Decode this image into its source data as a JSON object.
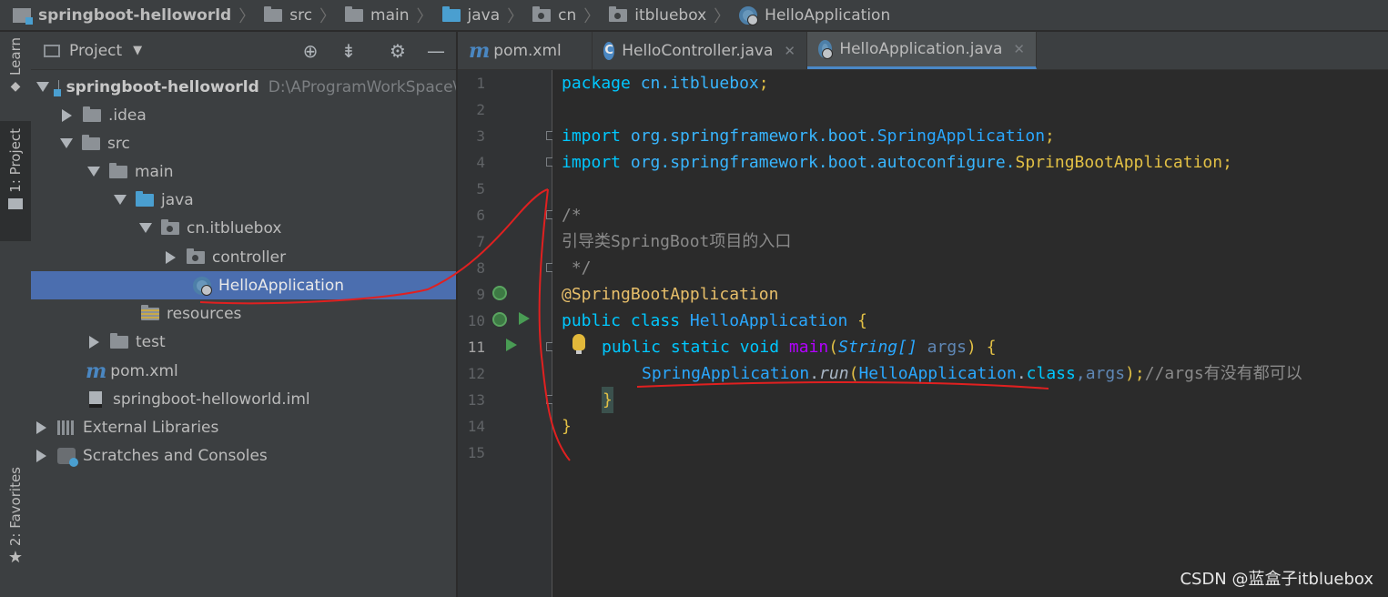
{
  "breadcrumb": {
    "items": [
      "springboot-helloworld",
      "src",
      "main",
      "java",
      "cn",
      "itbluebox",
      "HelloApplication"
    ]
  },
  "tool_strip": {
    "learn": "Learn",
    "project": "1: Project",
    "favorites": "2: Favorites"
  },
  "project_panel": {
    "title": "Project",
    "tree": [
      {
        "label": "springboot-helloworld",
        "hint": "D:\\AProgramWorkSpace\\i"
      },
      {
        "label": ".idea"
      },
      {
        "label": "src"
      },
      {
        "label": "main"
      },
      {
        "label": "java"
      },
      {
        "label": "cn.itbluebox"
      },
      {
        "label": "controller"
      },
      {
        "label": "HelloApplication"
      },
      {
        "label": "resources"
      },
      {
        "label": "test"
      },
      {
        "label": "pom.xml"
      },
      {
        "label": "springboot-helloworld.iml"
      },
      {
        "label": "External Libraries"
      },
      {
        "label": "Scratches and Consoles"
      }
    ]
  },
  "editor_tabs": [
    {
      "label": "pom.xml"
    },
    {
      "label": "HelloController.java"
    },
    {
      "label": "HelloApplication.java"
    }
  ],
  "gutter": {
    "lines": [
      "1",
      "2",
      "3",
      "4",
      "5",
      "6",
      "7",
      "8",
      "9",
      "10",
      "11",
      "12",
      "13",
      "14",
      "15"
    ]
  },
  "code": {
    "l1": {
      "kw": "package",
      "pkg": "cn.itbluebox",
      "semi": ";"
    },
    "l3": {
      "kw": "import",
      "pkg": "org.springframework.boot.",
      "cls": "SpringApplication",
      "semi": ";"
    },
    "l4": {
      "kw": "import",
      "pkg": "org.springframework.boot.autoconfigure.",
      "cls": "SpringBootApplication",
      "semi": ";"
    },
    "l6": "/*",
    "l7": "引导类SpringBoot项目的入口",
    "l8": " */",
    "l9": "@SpringBootApplication",
    "l10": {
      "kw": "public class",
      "cls": "HelloApplication",
      "brace": "{"
    },
    "l11": {
      "kw": "public static void",
      "mn": "main",
      "p1": "(",
      "typ": "String[]",
      "prm": "args",
      "p2": ") {"
    },
    "l12": {
      "cls1": "SpringApplication",
      "dot": ".",
      "mth": "run",
      "p1": "(",
      "cls2": "HelloApplication",
      "dot2": ".",
      "kwc": "class",
      "rest": ",args",
      "p2": ");",
      "cm": "//args有没有都可以"
    },
    "l13": "}",
    "l14": "}"
  },
  "watermark": "CSDN @蓝盒子itbluebox",
  "colors": {
    "annotation_red": "#e02020",
    "selection": "#4b6eaf",
    "tab_underline": "#4a88c7"
  }
}
